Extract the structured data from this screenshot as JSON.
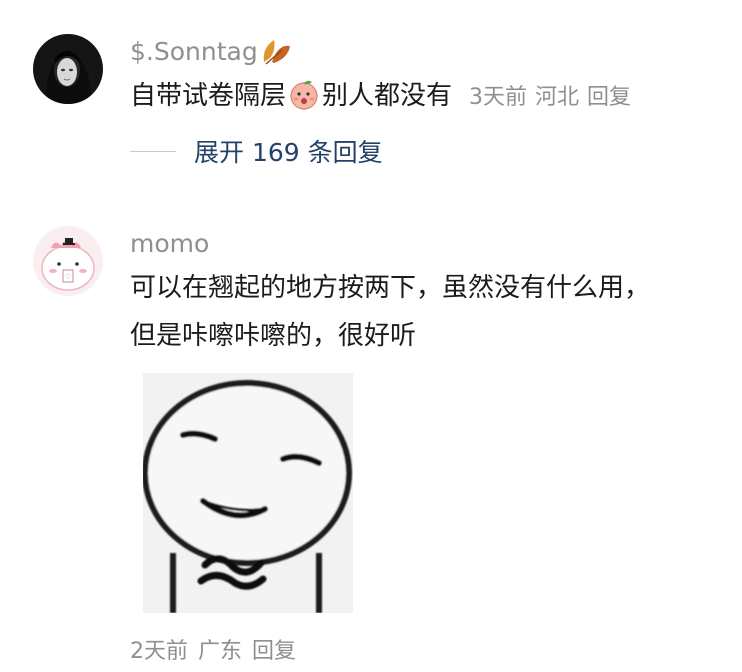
{
  "comments": [
    {
      "username": "$.Sonntag",
      "username_suffix_icon": "autumn-leaf-icon",
      "text_before_emoji": "自带试卷隔层",
      "inline_emoji": "peach-face-emoji",
      "text_after_emoji": "别人都没有",
      "time": "3天前",
      "location": "河北",
      "reply_label": "回复",
      "expand_replies": "展开 169 条回复"
    },
    {
      "username": "momo",
      "text_line1": "可以在翘起的地方按两下，虽然没有什么用，",
      "text_line2": "但是咔嚓咔嚓的，很好听",
      "sticker": "smiling-doodle-sticker",
      "time": "2天前",
      "location": "广东",
      "reply_label": "回复"
    }
  ],
  "colors": {
    "meta_text": "#8f8f8f",
    "link": "#24416b",
    "body_text": "#1b1b1b"
  }
}
